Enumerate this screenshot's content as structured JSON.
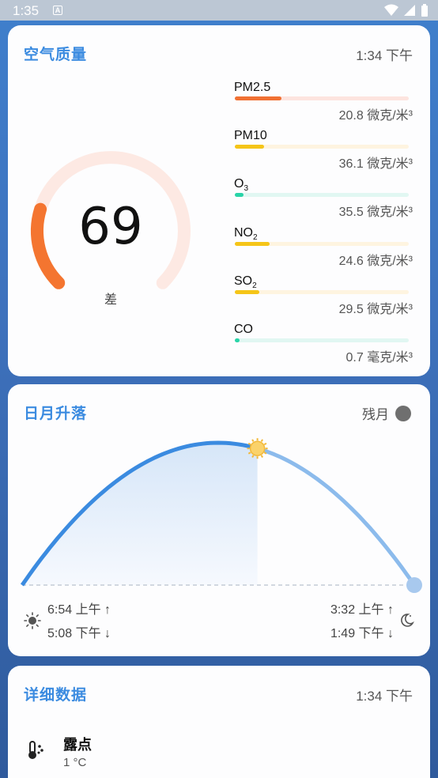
{
  "status_bar": {
    "time": "1:35",
    "notification_icon": "A",
    "icons": [
      "wifi-icon",
      "signal-icon",
      "battery-icon"
    ]
  },
  "air_quality": {
    "title": "空气质量",
    "time": "1:34 下午",
    "aqi": "69",
    "aqi_level": "差",
    "aqi_fraction": 0.23,
    "gauge_color": "#f47530",
    "gauge_track_color": "#fde9e3",
    "pollutants": [
      {
        "name": "PM2.5",
        "sub": "",
        "value": "20.8 微克/米³",
        "fraction": 0.27,
        "color": "#f07033",
        "track": "#fde4df"
      },
      {
        "name": "PM10",
        "sub": "",
        "value": "36.1 微克/米³",
        "fraction": 0.17,
        "color": "#f5c518",
        "track": "#fef4e0"
      },
      {
        "name": "O",
        "sub": "3",
        "value": "35.5 微克/米³",
        "fraction": 0.05,
        "color": "#29d4a8",
        "track": "#e1f7f2"
      },
      {
        "name": "NO",
        "sub": "2",
        "value": "24.6 微克/米³",
        "fraction": 0.2,
        "color": "#f5c518",
        "track": "#fef4e0"
      },
      {
        "name": "SO",
        "sub": "2",
        "value": "29.5 微克/米³",
        "fraction": 0.14,
        "color": "#f5c518",
        "track": "#fef4e0"
      },
      {
        "name": "CO",
        "sub": "",
        "value": "0.7 毫克/米³",
        "fraction": 0.02,
        "color": "#29d4a8",
        "track": "#e1f7f2"
      }
    ]
  },
  "sun_moon": {
    "title": "日月升落",
    "moon_phase": "残月",
    "sun_progress": 0.6,
    "sunrise": "6:54 上午 ↑",
    "sunset": "5:08 下午 ↓",
    "moonrise": "3:32 上午 ↑",
    "moonset": "1:49 下午 ↓",
    "arc_color": "#3b8be0"
  },
  "details": {
    "title": "详细数据",
    "time": "1:34 下午",
    "items": [
      {
        "label": "露点",
        "value": "1 °C",
        "icon": "thermometer-icon"
      }
    ]
  }
}
